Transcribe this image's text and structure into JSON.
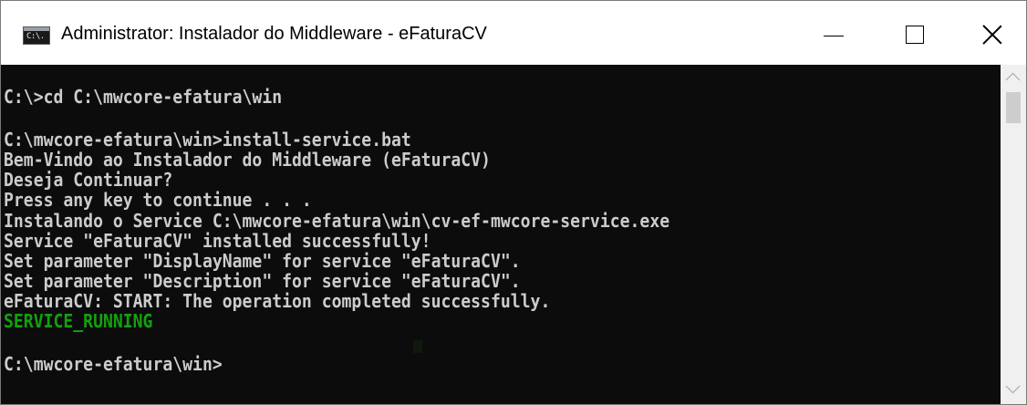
{
  "window": {
    "title": "Administrator: Instalador do Middleware - eFaturaCV",
    "app_icon_glyph": "C:\\.",
    "icon": "console-icon",
    "controls": {
      "minimize_icon": "minimize-icon",
      "maximize_icon": "maximize-icon",
      "close_icon": "close-icon"
    }
  },
  "console": {
    "background": "#0c0c0c",
    "text_color": "#cccccc",
    "status_color": "#13a10e",
    "lines": [
      "C:\\>cd C:\\mwcore-efatura\\win",
      "",
      "C:\\mwcore-efatura\\win>install-service.bat",
      "Bem-Vindo ao Instalador do Middleware (eFaturaCV)",
      "Deseja Continuar?",
      "Press any key to continue . . .",
      "Instalando o Service C:\\mwcore-efatura\\win\\cv-ef-mwcore-service.exe",
      "Service \"eFaturaCV\" installed successfully!",
      "Set parameter \"DisplayName\" for service \"eFaturaCV\".",
      "Set parameter \"Description\" for service \"eFaturaCV\".",
      "eFaturaCV: START: The operation completed successfully.",
      "SERVICE_RUNNING",
      "",
      "C:\\mwcore-efatura\\win>"
    ]
  },
  "scrollbar": {
    "up_icon": "chevron-up-icon",
    "down_icon": "chevron-down-icon"
  }
}
